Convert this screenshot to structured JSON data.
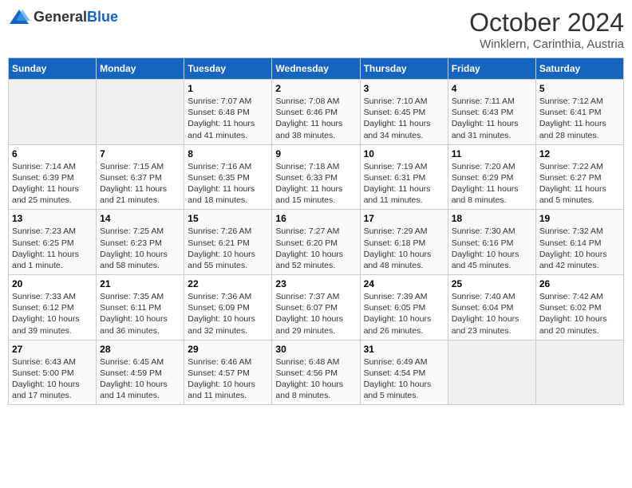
{
  "header": {
    "logo_general": "General",
    "logo_blue": "Blue",
    "month_title": "October 2024",
    "subtitle": "Winklern, Carinthia, Austria"
  },
  "weekdays": [
    "Sunday",
    "Monday",
    "Tuesday",
    "Wednesday",
    "Thursday",
    "Friday",
    "Saturday"
  ],
  "weeks": [
    [
      {
        "num": "",
        "sunrise": "",
        "sunset": "",
        "daylight": "",
        "empty": true
      },
      {
        "num": "",
        "sunrise": "",
        "sunset": "",
        "daylight": "",
        "empty": true
      },
      {
        "num": "1",
        "sunrise": "Sunrise: 7:07 AM",
        "sunset": "Sunset: 6:48 PM",
        "daylight": "Daylight: 11 hours and 41 minutes."
      },
      {
        "num": "2",
        "sunrise": "Sunrise: 7:08 AM",
        "sunset": "Sunset: 6:46 PM",
        "daylight": "Daylight: 11 hours and 38 minutes."
      },
      {
        "num": "3",
        "sunrise": "Sunrise: 7:10 AM",
        "sunset": "Sunset: 6:45 PM",
        "daylight": "Daylight: 11 hours and 34 minutes."
      },
      {
        "num": "4",
        "sunrise": "Sunrise: 7:11 AM",
        "sunset": "Sunset: 6:43 PM",
        "daylight": "Daylight: 11 hours and 31 minutes."
      },
      {
        "num": "5",
        "sunrise": "Sunrise: 7:12 AM",
        "sunset": "Sunset: 6:41 PM",
        "daylight": "Daylight: 11 hours and 28 minutes."
      }
    ],
    [
      {
        "num": "6",
        "sunrise": "Sunrise: 7:14 AM",
        "sunset": "Sunset: 6:39 PM",
        "daylight": "Daylight: 11 hours and 25 minutes."
      },
      {
        "num": "7",
        "sunrise": "Sunrise: 7:15 AM",
        "sunset": "Sunset: 6:37 PM",
        "daylight": "Daylight: 11 hours and 21 minutes."
      },
      {
        "num": "8",
        "sunrise": "Sunrise: 7:16 AM",
        "sunset": "Sunset: 6:35 PM",
        "daylight": "Daylight: 11 hours and 18 minutes."
      },
      {
        "num": "9",
        "sunrise": "Sunrise: 7:18 AM",
        "sunset": "Sunset: 6:33 PM",
        "daylight": "Daylight: 11 hours and 15 minutes."
      },
      {
        "num": "10",
        "sunrise": "Sunrise: 7:19 AM",
        "sunset": "Sunset: 6:31 PM",
        "daylight": "Daylight: 11 hours and 11 minutes."
      },
      {
        "num": "11",
        "sunrise": "Sunrise: 7:20 AM",
        "sunset": "Sunset: 6:29 PM",
        "daylight": "Daylight: 11 hours and 8 minutes."
      },
      {
        "num": "12",
        "sunrise": "Sunrise: 7:22 AM",
        "sunset": "Sunset: 6:27 PM",
        "daylight": "Daylight: 11 hours and 5 minutes."
      }
    ],
    [
      {
        "num": "13",
        "sunrise": "Sunrise: 7:23 AM",
        "sunset": "Sunset: 6:25 PM",
        "daylight": "Daylight: 11 hours and 1 minute."
      },
      {
        "num": "14",
        "sunrise": "Sunrise: 7:25 AM",
        "sunset": "Sunset: 6:23 PM",
        "daylight": "Daylight: 10 hours and 58 minutes."
      },
      {
        "num": "15",
        "sunrise": "Sunrise: 7:26 AM",
        "sunset": "Sunset: 6:21 PM",
        "daylight": "Daylight: 10 hours and 55 minutes."
      },
      {
        "num": "16",
        "sunrise": "Sunrise: 7:27 AM",
        "sunset": "Sunset: 6:20 PM",
        "daylight": "Daylight: 10 hours and 52 minutes."
      },
      {
        "num": "17",
        "sunrise": "Sunrise: 7:29 AM",
        "sunset": "Sunset: 6:18 PM",
        "daylight": "Daylight: 10 hours and 48 minutes."
      },
      {
        "num": "18",
        "sunrise": "Sunrise: 7:30 AM",
        "sunset": "Sunset: 6:16 PM",
        "daylight": "Daylight: 10 hours and 45 minutes."
      },
      {
        "num": "19",
        "sunrise": "Sunrise: 7:32 AM",
        "sunset": "Sunset: 6:14 PM",
        "daylight": "Daylight: 10 hours and 42 minutes."
      }
    ],
    [
      {
        "num": "20",
        "sunrise": "Sunrise: 7:33 AM",
        "sunset": "Sunset: 6:12 PM",
        "daylight": "Daylight: 10 hours and 39 minutes."
      },
      {
        "num": "21",
        "sunrise": "Sunrise: 7:35 AM",
        "sunset": "Sunset: 6:11 PM",
        "daylight": "Daylight: 10 hours and 36 minutes."
      },
      {
        "num": "22",
        "sunrise": "Sunrise: 7:36 AM",
        "sunset": "Sunset: 6:09 PM",
        "daylight": "Daylight: 10 hours and 32 minutes."
      },
      {
        "num": "23",
        "sunrise": "Sunrise: 7:37 AM",
        "sunset": "Sunset: 6:07 PM",
        "daylight": "Daylight: 10 hours and 29 minutes."
      },
      {
        "num": "24",
        "sunrise": "Sunrise: 7:39 AM",
        "sunset": "Sunset: 6:05 PM",
        "daylight": "Daylight: 10 hours and 26 minutes."
      },
      {
        "num": "25",
        "sunrise": "Sunrise: 7:40 AM",
        "sunset": "Sunset: 6:04 PM",
        "daylight": "Daylight: 10 hours and 23 minutes."
      },
      {
        "num": "26",
        "sunrise": "Sunrise: 7:42 AM",
        "sunset": "Sunset: 6:02 PM",
        "daylight": "Daylight: 10 hours and 20 minutes."
      }
    ],
    [
      {
        "num": "27",
        "sunrise": "Sunrise: 6:43 AM",
        "sunset": "Sunset: 5:00 PM",
        "daylight": "Daylight: 10 hours and 17 minutes."
      },
      {
        "num": "28",
        "sunrise": "Sunrise: 6:45 AM",
        "sunset": "Sunset: 4:59 PM",
        "daylight": "Daylight: 10 hours and 14 minutes."
      },
      {
        "num": "29",
        "sunrise": "Sunrise: 6:46 AM",
        "sunset": "Sunset: 4:57 PM",
        "daylight": "Daylight: 10 hours and 11 minutes."
      },
      {
        "num": "30",
        "sunrise": "Sunrise: 6:48 AM",
        "sunset": "Sunset: 4:56 PM",
        "daylight": "Daylight: 10 hours and 8 minutes."
      },
      {
        "num": "31",
        "sunrise": "Sunrise: 6:49 AM",
        "sunset": "Sunset: 4:54 PM",
        "daylight": "Daylight: 10 hours and 5 minutes."
      },
      {
        "num": "",
        "sunrise": "",
        "sunset": "",
        "daylight": "",
        "empty": true
      },
      {
        "num": "",
        "sunrise": "",
        "sunset": "",
        "daylight": "",
        "empty": true
      }
    ]
  ]
}
